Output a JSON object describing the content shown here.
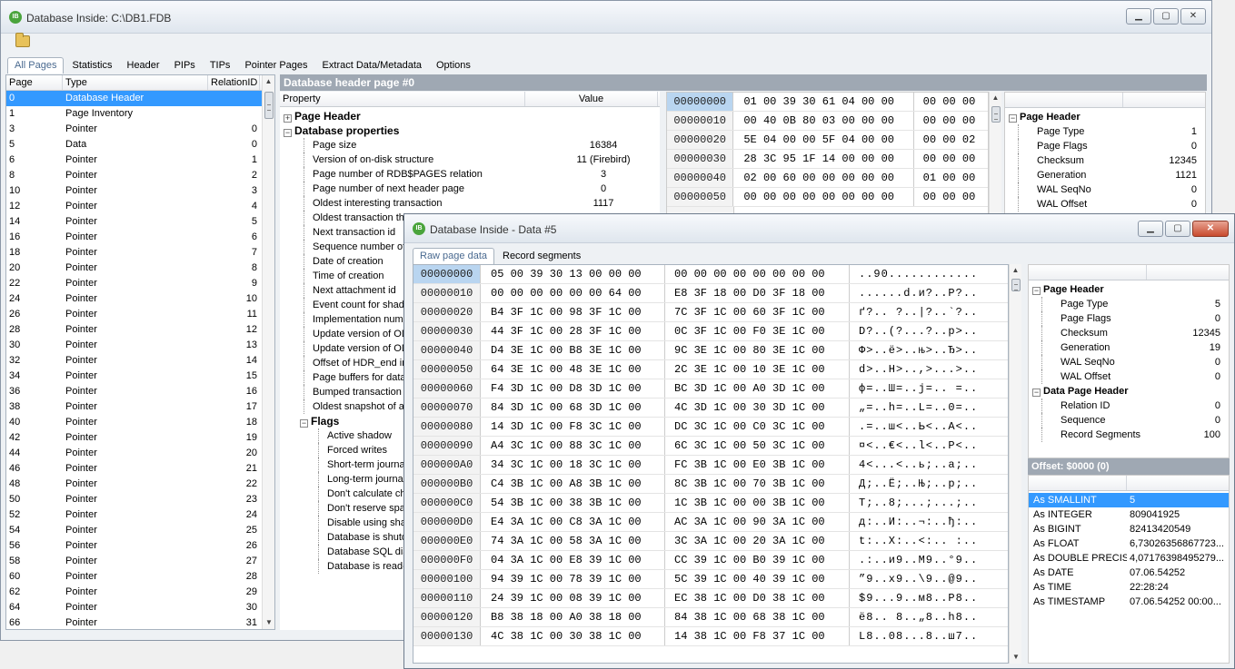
{
  "main": {
    "title": "Database Inside: C:\\DB1.FDB",
    "tabs": [
      "All Pages",
      "Statistics",
      "Header",
      "PIPs",
      "TIPs",
      "Pointer Pages",
      "Extract Data/Metadata",
      "Options"
    ],
    "pages_header": [
      "Page",
      "Type",
      "RelationID"
    ],
    "pages": [
      [
        "0",
        "Database Header",
        ""
      ],
      [
        "1",
        "Page Inventory",
        ""
      ],
      [
        "3",
        "Pointer",
        "0"
      ],
      [
        "5",
        "Data",
        "0"
      ],
      [
        "6",
        "Pointer",
        "1"
      ],
      [
        "8",
        "Pointer",
        "2"
      ],
      [
        "10",
        "Pointer",
        "3"
      ],
      [
        "12",
        "Pointer",
        "4"
      ],
      [
        "14",
        "Pointer",
        "5"
      ],
      [
        "16",
        "Pointer",
        "6"
      ],
      [
        "18",
        "Pointer",
        "7"
      ],
      [
        "20",
        "Pointer",
        "8"
      ],
      [
        "22",
        "Pointer",
        "9"
      ],
      [
        "24",
        "Pointer",
        "10"
      ],
      [
        "26",
        "Pointer",
        "11"
      ],
      [
        "28",
        "Pointer",
        "12"
      ],
      [
        "30",
        "Pointer",
        "13"
      ],
      [
        "32",
        "Pointer",
        "14"
      ],
      [
        "34",
        "Pointer",
        "15"
      ],
      [
        "36",
        "Pointer",
        "16"
      ],
      [
        "38",
        "Pointer",
        "17"
      ],
      [
        "40",
        "Pointer",
        "18"
      ],
      [
        "42",
        "Pointer",
        "19"
      ],
      [
        "44",
        "Pointer",
        "20"
      ],
      [
        "46",
        "Pointer",
        "21"
      ],
      [
        "48",
        "Pointer",
        "22"
      ],
      [
        "50",
        "Pointer",
        "23"
      ],
      [
        "52",
        "Pointer",
        "24"
      ],
      [
        "54",
        "Pointer",
        "25"
      ],
      [
        "56",
        "Pointer",
        "26"
      ],
      [
        "58",
        "Pointer",
        "27"
      ],
      [
        "60",
        "Pointer",
        "28"
      ],
      [
        "62",
        "Pointer",
        "29"
      ],
      [
        "64",
        "Pointer",
        "30"
      ],
      [
        "66",
        "Pointer",
        "31"
      ]
    ],
    "section_title": "Database header page #0",
    "prop_header": [
      "Property",
      "Value"
    ],
    "page_header_node": "Page Header",
    "db_props_node": "Database properties",
    "props": [
      [
        "Page size",
        "16384"
      ],
      [
        "Version of on-disk structure",
        "11 (Firebird)"
      ],
      [
        "Page number of RDB$PAGES relation",
        "3"
      ],
      [
        "Page number of next header page",
        "0"
      ],
      [
        "Oldest interesting transaction",
        "1117"
      ],
      [
        "Oldest transaction th",
        ""
      ],
      [
        "Next transaction id",
        ""
      ],
      [
        "Sequence number of",
        ""
      ],
      [
        "Date of creation",
        ""
      ],
      [
        "Time of creation",
        ""
      ],
      [
        "Next attachment id",
        ""
      ],
      [
        "Event count for shad",
        ""
      ],
      [
        "Implementation numb",
        ""
      ],
      [
        "Update version of OD",
        ""
      ],
      [
        "Update version of OD",
        ""
      ],
      [
        "Offset of HDR_end in",
        ""
      ],
      [
        "Page buffers for data",
        ""
      ],
      [
        "Bumped transaction i",
        ""
      ],
      [
        "Oldest snapshot of ac",
        ""
      ]
    ],
    "flags_node": "Flags",
    "flags": [
      "Active shadow",
      "Forced writes",
      "Short-term journa",
      "Long-term journal",
      "Don't calculate che",
      "Don't reserve spa",
      "Disable using shar",
      "Database is shutd",
      "Database SQL dia",
      "Database is read-"
    ],
    "hex": [
      [
        "00000000",
        "01 00 39 30 61 04 00 00",
        "00 00 00"
      ],
      [
        "00000010",
        "00 40 0B 80 03 00 00 00",
        "00 00 00"
      ],
      [
        "00000020",
        "5E 04 00 00 5F 04 00 00",
        "00 00 02"
      ],
      [
        "00000030",
        "28 3C 95 1F 14 00 00 00",
        "00 00 00"
      ],
      [
        "00000040",
        "02 00 60 00 00 00 00 00",
        "01 00 00"
      ],
      [
        "00000050",
        "00 00 00 00 00 00 00 00",
        "00 00 00"
      ]
    ],
    "right_header": "Page Header",
    "right_props": [
      [
        "Page Type",
        "1"
      ],
      [
        "Page Flags",
        "0"
      ],
      [
        "Checksum",
        "12345"
      ],
      [
        "Generation",
        "1121"
      ],
      [
        "WAL SeqNo",
        "0"
      ],
      [
        "WAL Offset",
        "0"
      ]
    ]
  },
  "data_win": {
    "title": "Database Inside - Data #5",
    "tabs": [
      "Raw page data",
      "Record segments"
    ],
    "hex": [
      [
        "00000000",
        "05 00 39 30 13 00 00 00",
        "00 00 00 00 00 00 00 00",
        "..90............"
      ],
      [
        "00000010",
        "00 00 00 00 00 00 64 00",
        "E8 3F 18 00 D0 3F 18 00",
        "......d.и?..Р?.."
      ],
      [
        "00000020",
        "B4 3F 1C 00 98 3F 1C 00",
        "7C 3F 1C 00 60 3F 1C 00",
        "ґ?.. ?..|?..`?.."
      ],
      [
        "00000030",
        "44 3F 1C 00 28 3F 1C 00",
        "0C 3F 1C 00 F0 3E 1C 00",
        "D?..(?...?..p>.."
      ],
      [
        "00000040",
        "D4 3E 1C 00 B8 3E 1C 00",
        "9C 3E 1C 00 80 3E 1C 00",
        "Ф>..ё>..њ>..Ђ>.."
      ],
      [
        "00000050",
        "64 3E 1C 00 48 3E 1C 00",
        "2C 3E 1C 00 10 3E 1C 00",
        "d>..H>..,>...>.."
      ],
      [
        "00000060",
        "F4 3D 1C 00 D8 3D 1C 00",
        "BC 3D 1C 00 A0 3D 1C 00",
        "ф=..Ш=..ј=..  =.."
      ],
      [
        "00000070",
        "84 3D 1C 00 68 3D 1C 00",
        "4C 3D 1C 00 30 3D 1C 00",
        "„=..h=..L=..0=.."
      ],
      [
        "00000080",
        "14 3D 1C 00 F8 3C 1C 00",
        "DC 3C 1C 00 C0 3C 1C 00",
        ".=..ш<..Ь<..А<.."
      ],
      [
        "00000090",
        "A4 3C 1C 00 88 3C 1C 00",
        "6C 3C 1C 00 50 3C 1C 00",
        "¤<..€<..l<..P<.."
      ],
      [
        "000000A0",
        "34 3C 1C 00 18 3C 1C 00",
        "FC 3B 1C 00 E0 3B 1C 00",
        "4<...<..ь;..а;.."
      ],
      [
        "000000B0",
        "C4 3B 1C 00 A8 3B 1C 00",
        "8C 3B 1C 00 70 3B 1C 00",
        "Д;..Ё;..Њ;..p;.."
      ],
      [
        "000000C0",
        "54 3B 1C 00 38 3B 1C 00",
        "1C 3B 1C 00 00 3B 1C 00",
        "T;..8;...;...;.."
      ],
      [
        "000000D0",
        "E4 3A 1C 00 C8 3A 1C 00",
        "AC 3A 1C 00 90 3A 1C 00",
        "д:..И:..¬:..ђ:.."
      ],
      [
        "000000E0",
        "74 3A 1C 00 58 3A 1C 00",
        "3C 3A 1C 00 20 3A 1C 00",
        "t:..X:..<:.. :.."
      ],
      [
        "000000F0",
        "04 3A 1C 00 E8 39 1C 00",
        "CC 39 1C 00 B0 39 1C 00",
        ".:..и9..М9..°9.."
      ],
      [
        "00000100",
        "94 39 1C 00 78 39 1C 00",
        "5C 39 1C 00 40 39 1C 00",
        "”9..x9..\\9..@9.."
      ],
      [
        "00000110",
        "24 39 1C 00 08 39 1C 00",
        "EC 38 1C 00 D0 38 1C 00",
        "$9...9..м8..Р8.."
      ],
      [
        "00000120",
        "B8 38 18 00 A0 38 18 00",
        "84 38 1C 00 68 38 1C 00",
        "ё8..  8..„8..h8.."
      ],
      [
        "00000130",
        "4C 38 1C 00 30 38 1C 00",
        "14 38 1C 00 F8 37 1C 00",
        "L8..08...8..ш7.."
      ]
    ],
    "page_header_node": "Page Header",
    "page_header": [
      [
        "Page Type",
        "5"
      ],
      [
        "Page Flags",
        "0"
      ],
      [
        "Checksum",
        "12345"
      ],
      [
        "Generation",
        "19"
      ],
      [
        "WAL SeqNo",
        "0"
      ],
      [
        "WAL Offset",
        "0"
      ]
    ],
    "data_header_node": "Data Page Header",
    "data_header": [
      [
        "Relation ID",
        "0"
      ],
      [
        "Sequence",
        "0"
      ],
      [
        "Record Segments",
        "100"
      ]
    ],
    "offset_title": "Offset: $0000 (0)",
    "interp": [
      [
        "As SMALLINT",
        "5"
      ],
      [
        "As INTEGER",
        "809041925"
      ],
      [
        "As BIGINT",
        "82413420549"
      ],
      [
        "As FLOAT",
        "6,73026356867723..."
      ],
      [
        "As DOUBLE PRECIS...",
        "4,07176398495279..."
      ],
      [
        "As DATE",
        "07.06.54252"
      ],
      [
        "As TIME",
        "22:28:24"
      ],
      [
        "As TIMESTAMP",
        "07.06.54252 00:00..."
      ]
    ]
  }
}
